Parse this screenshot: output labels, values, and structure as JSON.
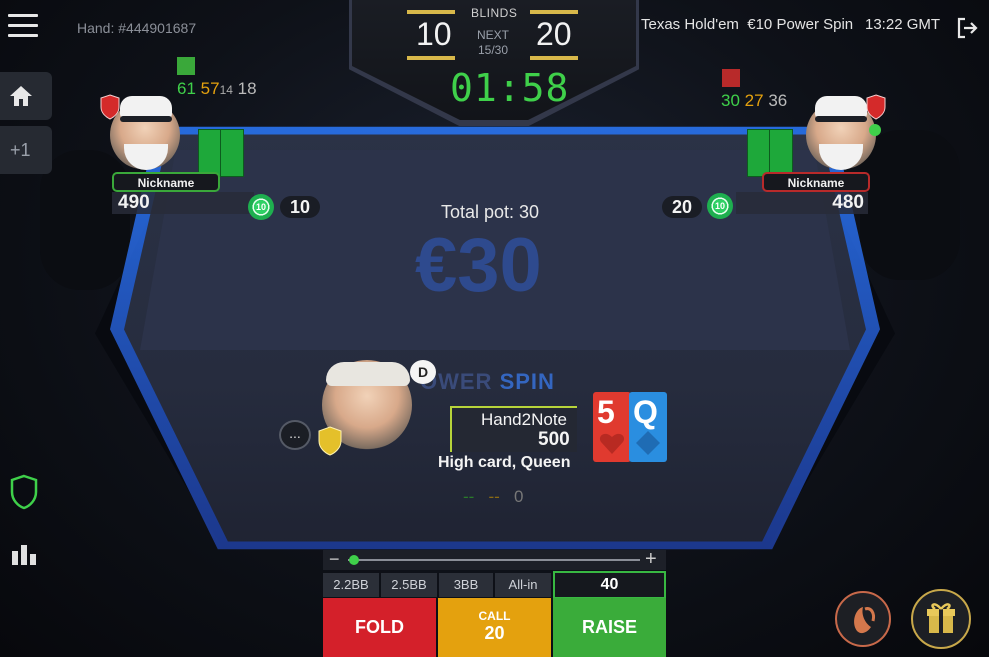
{
  "header": {
    "hand_id": "Hand: #444901687",
    "game_name": "Texas Hold'em",
    "game_stake": "€10 Power Spin",
    "time": "13:22 GMT"
  },
  "blinds": {
    "label": "BLINDS",
    "small": "10",
    "big": "20",
    "next_label": "NEXT",
    "next_count": "15/30",
    "timer": "01:58"
  },
  "sidebar": {
    "plus_one": "+1"
  },
  "table": {
    "total_pot": "Total pot: 30",
    "pot_big": "€30",
    "logo_left": "OWER",
    "logo_right": "SPIN"
  },
  "players": {
    "left": {
      "nickname": "Nickname",
      "stack": "490",
      "bet": "10",
      "chip": "10",
      "stats": [
        "61",
        "57",
        "14",
        "18"
      ]
    },
    "right": {
      "nickname": "Nickname",
      "stack": "480",
      "bet": "20",
      "chip": "10",
      "stats": [
        "30",
        "27",
        "36"
      ]
    },
    "hero": {
      "name": "Hand2Note",
      "stack": "500",
      "hand": "High card, Queen",
      "dealer": "D",
      "chat": "...",
      "cards": [
        {
          "rank": "5",
          "color": "#e03a2f"
        },
        {
          "rank": "Q",
          "color": "#2a8ee0"
        }
      ],
      "stats": [
        "--",
        "--",
        "0"
      ]
    }
  },
  "actions": {
    "slider_minus": "−",
    "slider_plus": "+",
    "presets": [
      "2.2BB",
      "2.5BB",
      "3BB",
      "All-in"
    ],
    "raise_amount": "40",
    "fold": "FOLD",
    "call_label": "CALL",
    "call_amount": "20",
    "raise": "RAISE"
  },
  "colors": {
    "fold": "#d4202a",
    "call": "#e4a10e",
    "raise": "#3aac3a",
    "timer": "#3fd04a",
    "table_rim": "#2b7bff"
  }
}
